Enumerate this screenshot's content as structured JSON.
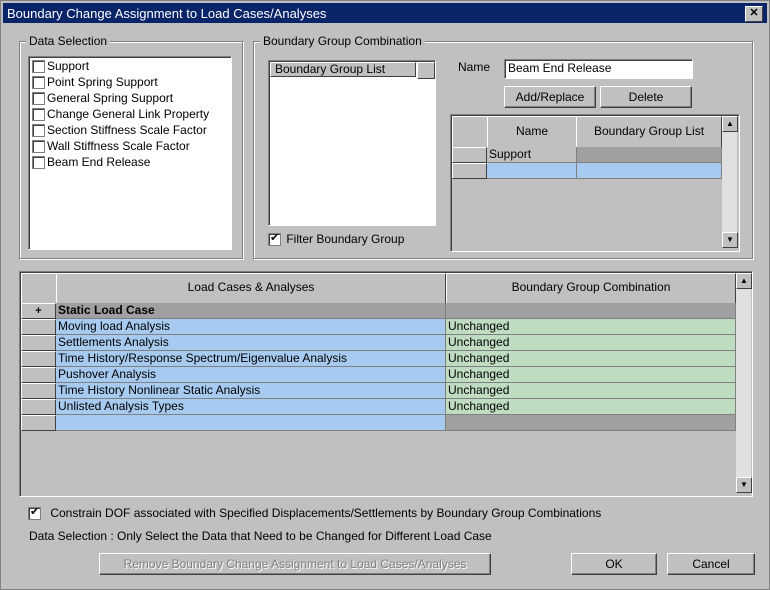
{
  "window": {
    "title": "Boundary Change Assignment to Load Cases/Analyses",
    "close": "✕"
  },
  "data_selection": {
    "legend": "Data Selection",
    "items": [
      {
        "label": "Support",
        "checked": false
      },
      {
        "label": "Point Spring Support",
        "checked": false
      },
      {
        "label": "General Spring Support",
        "checked": false
      },
      {
        "label": "Change General Link Property",
        "checked": false
      },
      {
        "label": "Section Stiffness Scale Factor",
        "checked": false
      },
      {
        "label": "Wall Stiffness Scale Factor",
        "checked": false
      },
      {
        "label": "Beam End Release",
        "checked": false
      }
    ]
  },
  "bgc": {
    "legend": "Boundary Group Combination",
    "list_header": "Boundary Group List",
    "filter_label": "Filter Boundary Group",
    "filter_checked": true,
    "name_label": "Name",
    "name_value": "Beam End Release",
    "add_replace": "Add/Replace",
    "delete": "Delete",
    "grid_headers": [
      "Name",
      "Boundary Group List"
    ],
    "grid_rows": [
      [
        "Support",
        ""
      ],
      [
        "",
        ""
      ]
    ]
  },
  "load_grid": {
    "headers": [
      "Load Cases & Analyses",
      "Boundary Group Combination"
    ],
    "rows": [
      {
        "marker": "+",
        "name": "Static Load Case",
        "value": "",
        "kind": "group"
      },
      {
        "marker": "",
        "name": "Moving load Analysis",
        "value": "Unchanged",
        "kind": "row"
      },
      {
        "marker": "",
        "name": "Settlements Analysis",
        "value": "Unchanged",
        "kind": "row"
      },
      {
        "marker": "",
        "name": "Time History/Response Spectrum/Eigenvalue Analysis",
        "value": "Unchanged",
        "kind": "row"
      },
      {
        "marker": "",
        "name": "Pushover Analysis",
        "value": "Unchanged",
        "kind": "row"
      },
      {
        "marker": "",
        "name": "Time History Nonlinear Static Analysis",
        "value": "Unchanged",
        "kind": "row"
      },
      {
        "marker": "",
        "name": "Unlisted Analysis Types",
        "value": "Unchanged",
        "kind": "row"
      },
      {
        "marker": "",
        "name": "",
        "value": "",
        "kind": "empty"
      }
    ]
  },
  "constrain": {
    "label": "Constrain DOF associated with Specified Displacements/Settlements by Boundary Group Combinations",
    "checked": true
  },
  "note": "Data Selection : Only Select the Data that Need to be Changed for Different Load Case",
  "buttons": {
    "remove": "Remove Boundary Change Assignment to Load Cases/Analyses",
    "ok": "OK",
    "cancel": "Cancel"
  },
  "colors": {
    "title_bg": "#0a246a",
    "row_blue": "#a6caf0",
    "row_green": "#c0dcc0"
  }
}
